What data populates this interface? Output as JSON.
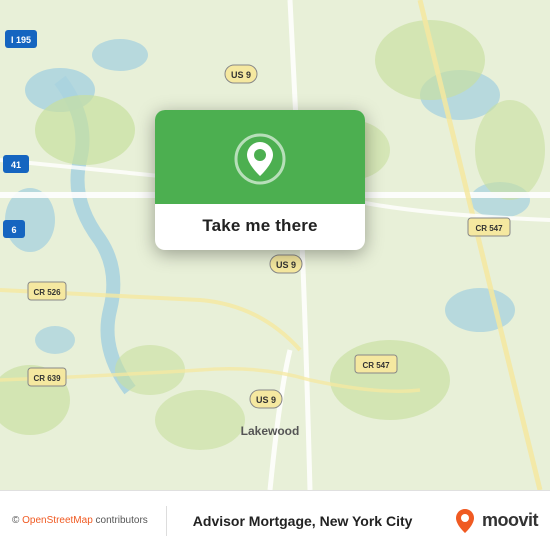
{
  "map": {
    "popup": {
      "button_label": "Take me there",
      "pin_icon": "location-pin"
    },
    "copyright": "© OpenStreetMap contributors",
    "osm_text": "OpenStreetMap"
  },
  "bottom_bar": {
    "title": "Advisor Mortgage, New York City",
    "moovit_text": "moovit"
  }
}
